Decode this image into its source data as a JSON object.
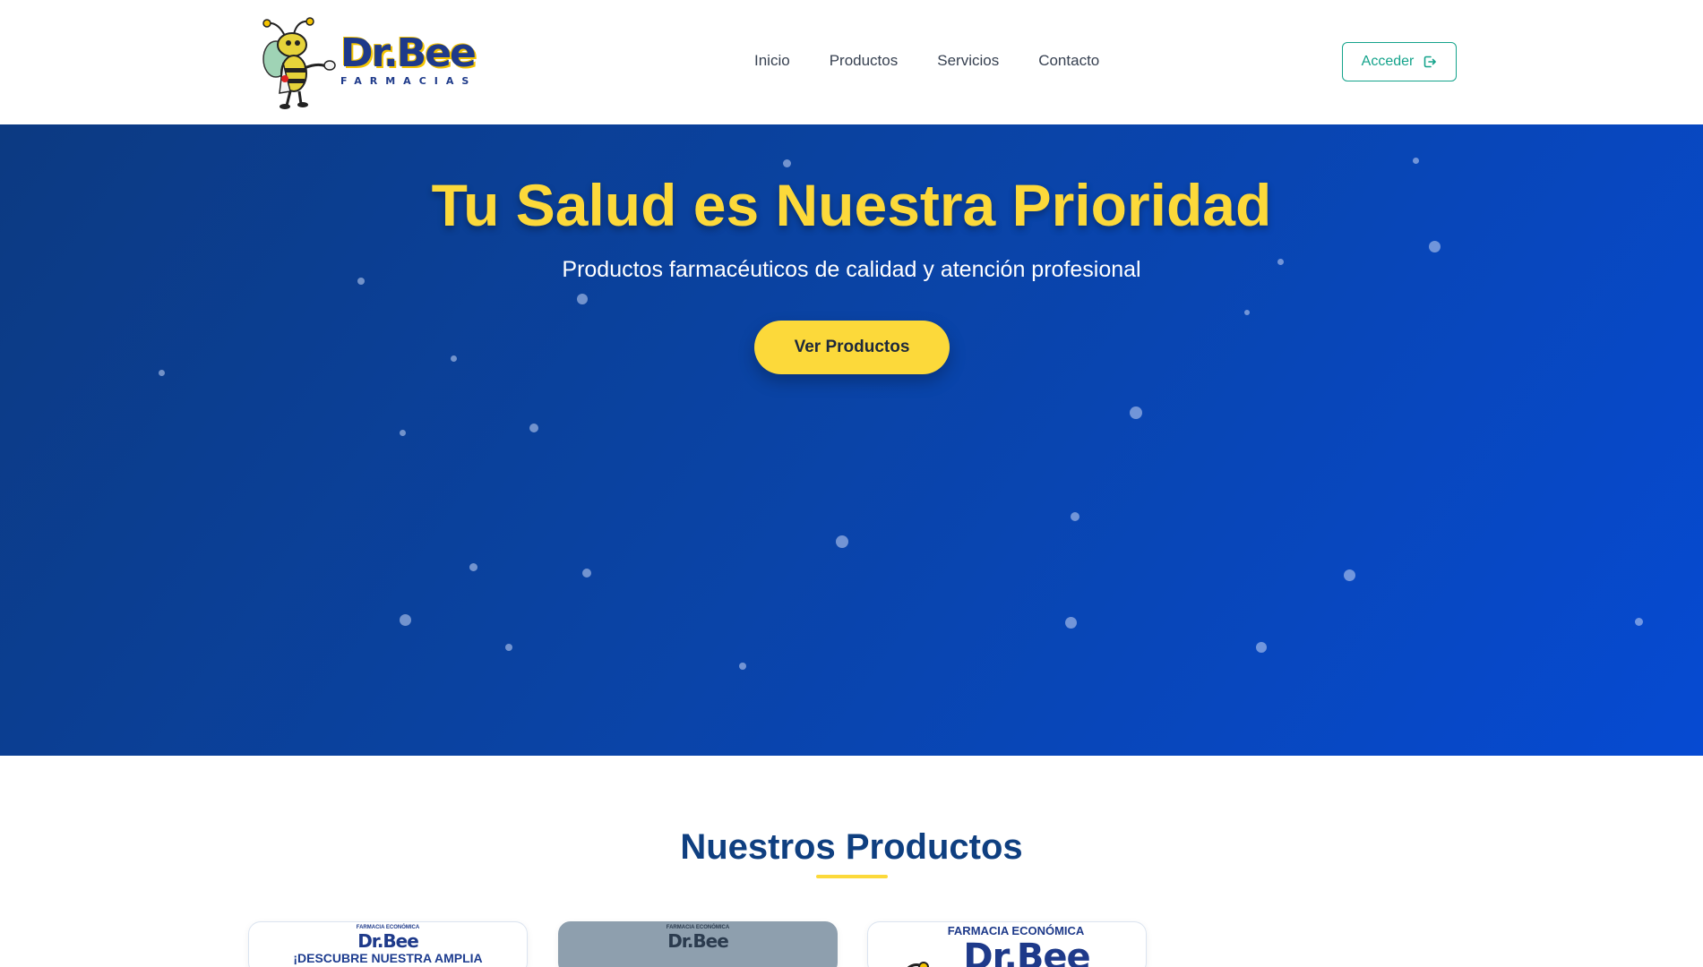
{
  "brand": {
    "name": "Dr.Bee",
    "tagline": "FARMACIAS"
  },
  "nav": {
    "items": [
      {
        "label": "Inicio"
      },
      {
        "label": "Productos"
      },
      {
        "label": "Servicios"
      },
      {
        "label": "Contacto"
      }
    ],
    "login_label": "Acceder"
  },
  "hero": {
    "title": "Tu Salud es Nuestra Prioridad",
    "subtitle": "Productos farmacéuticos de calidad y atención profesional",
    "cta_label": "Ver Productos"
  },
  "products": {
    "heading": "Nuestros Productos",
    "cards": [
      {
        "header": "FARMACIA ECONÓMICA",
        "brand": "Dr.Bee",
        "text": "¡DESCUBRE NUESTRA AMPLIA"
      },
      {
        "header": "FARMACIA ECONÓMICA",
        "brand": "Dr.Bee",
        "text": ""
      },
      {
        "header": "FARMACIA ECONÓMICA",
        "brand": "Dr.Bee",
        "text": ""
      }
    ]
  },
  "colors": {
    "accent_yellow": "#fcd93a",
    "brand_blue": "#1e3a8a",
    "login_teal": "#14a38b",
    "heading_blue": "#0f3f80"
  }
}
